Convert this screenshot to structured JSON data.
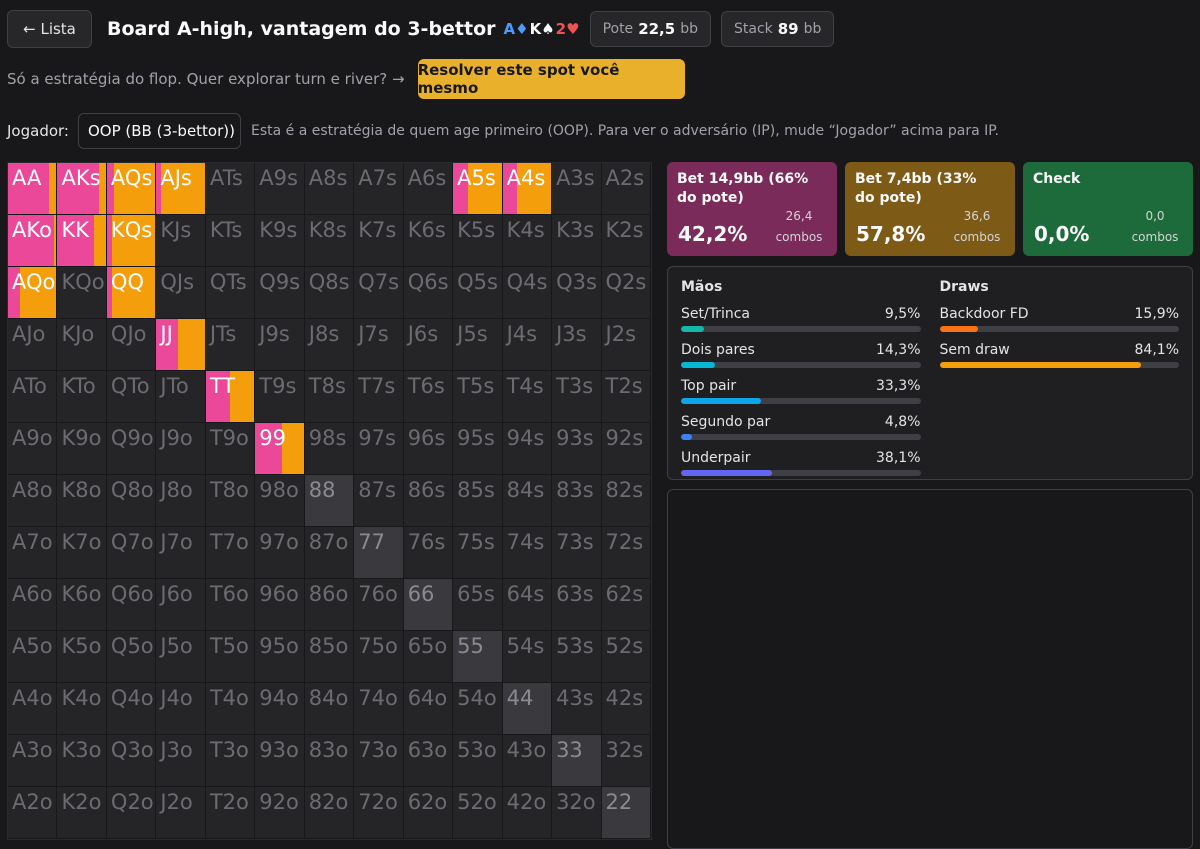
{
  "header": {
    "back_label": "← Lista",
    "title": "Board A-high, vantagem do 3-bettor",
    "board": [
      {
        "rank": "A",
        "suit": "♦",
        "color": "#4b9bff"
      },
      {
        "rank": "K",
        "suit": "♠",
        "color": "#fafafa"
      },
      {
        "rank": "2",
        "suit": "♥",
        "color": "#f05252"
      }
    ],
    "pot_label": "Pote",
    "pot_value": "22,5",
    "pot_unit": "bb",
    "stack_label": "Stack",
    "stack_value": "89",
    "stack_unit": "bb"
  },
  "cta": {
    "text": "Só a estratégia do flop. Quer explorar turn e river? →",
    "button": "Resolver este spot você mesmo"
  },
  "player": {
    "label": "Jogador:",
    "selected": "OOP (BB (3-bettor))",
    "help": "Esta é a estratégia de quem age primeiro (OOP). Para ver o adversário (IP), mude “Jogador” acima para IP."
  },
  "colors": {
    "bet_large": "#ec4899",
    "bet_small": "#f59e0b",
    "check": "#22c55e"
  },
  "actions": [
    {
      "name": "Bet 14,9bb (66% do pote)",
      "pct": "42,2%",
      "combos_value": "26,4",
      "combos_label": "combos",
      "bg": "#7a2b59"
    },
    {
      "name": "Bet 7,4bb (33% do pote)",
      "pct": "57,8%",
      "combos_value": "36,6",
      "combos_label": "combos",
      "bg": "#7d5a16"
    },
    {
      "name": "Check",
      "pct": "0,0%",
      "combos_value": "0,0",
      "combos_label": "combos",
      "bg": "#1d6b3a"
    }
  ],
  "stats": {
    "hands_title": "Mãos",
    "hands": [
      {
        "name": "Set/Trinca",
        "pct": "9,5%",
        "fraction": 0.095,
        "color": "#14b8a6"
      },
      {
        "name": "Dois pares",
        "pct": "14,3%",
        "fraction": 0.143,
        "color": "#06b6d4"
      },
      {
        "name": "Top pair",
        "pct": "33,3%",
        "fraction": 0.333,
        "color": "#0ea5e9"
      },
      {
        "name": "Segundo par",
        "pct": "4,8%",
        "fraction": 0.048,
        "color": "#3b82f6"
      },
      {
        "name": "Underpair",
        "pct": "38,1%",
        "fraction": 0.381,
        "color": "#6366f1"
      }
    ],
    "draws_title": "Draws",
    "draws": [
      {
        "name": "Backdoor FD",
        "pct": "15,9%",
        "fraction": 0.159,
        "color": "#f97316"
      },
      {
        "name": "Sem draw",
        "pct": "84,1%",
        "fraction": 0.841,
        "color": "#f59e0b"
      }
    ]
  },
  "matrix": {
    "rows": [
      [
        "AA",
        "AKs",
        "AQs",
        "AJs",
        "ATs",
        "A9s",
        "A8s",
        "A7s",
        "A6s",
        "A5s",
        "A4s",
        "A3s",
        "A2s"
      ],
      [
        "AKo",
        "KK",
        "KQs",
        "KJs",
        "KTs",
        "K9s",
        "K8s",
        "K7s",
        "K6s",
        "K5s",
        "K4s",
        "K3s",
        "K2s"
      ],
      [
        "AQo",
        "KQo",
        "QQ",
        "QJs",
        "QTs",
        "Q9s",
        "Q8s",
        "Q7s",
        "Q6s",
        "Q5s",
        "Q4s",
        "Q3s",
        "Q2s"
      ],
      [
        "AJo",
        "KJo",
        "QJo",
        "JJ",
        "JTs",
        "J9s",
        "J8s",
        "J7s",
        "J6s",
        "J5s",
        "J4s",
        "J3s",
        "J2s"
      ],
      [
        "ATo",
        "KTo",
        "QTo",
        "JTo",
        "TT",
        "T9s",
        "T8s",
        "T7s",
        "T6s",
        "T5s",
        "T4s",
        "T3s",
        "T2s"
      ],
      [
        "A9o",
        "K9o",
        "Q9o",
        "J9o",
        "T9o",
        "99",
        "98s",
        "97s",
        "96s",
        "95s",
        "94s",
        "93s",
        "92s"
      ],
      [
        "A8o",
        "K8o",
        "Q8o",
        "J8o",
        "T8o",
        "98o",
        "88",
        "87s",
        "86s",
        "85s",
        "84s",
        "83s",
        "82s"
      ],
      [
        "A7o",
        "K7o",
        "Q7o",
        "J7o",
        "T7o",
        "97o",
        "87o",
        "77",
        "76s",
        "75s",
        "74s",
        "73s",
        "72s"
      ],
      [
        "A6o",
        "K6o",
        "Q6o",
        "J6o",
        "T6o",
        "96o",
        "86o",
        "76o",
        "66",
        "65s",
        "64s",
        "63s",
        "62s"
      ],
      [
        "A5o",
        "K5o",
        "Q5o",
        "J5o",
        "T5o",
        "95o",
        "85o",
        "75o",
        "65o",
        "55",
        "54s",
        "53s",
        "52s"
      ],
      [
        "A4o",
        "K4o",
        "Q4o",
        "J4o",
        "T4o",
        "94o",
        "84o",
        "74o",
        "64o",
        "54o",
        "44",
        "43s",
        "42s"
      ],
      [
        "A3o",
        "K3o",
        "Q3o",
        "J3o",
        "T3o",
        "93o",
        "83o",
        "73o",
        "63o",
        "53o",
        "43o",
        "33",
        "32s"
      ],
      [
        "A2o",
        "K2o",
        "Q2o",
        "J2o",
        "T2o",
        "92o",
        "82o",
        "72o",
        "62o",
        "52o",
        "42o",
        "32o",
        "22"
      ]
    ],
    "strategy": {
      "AA": [
        0.85,
        0.15
      ],
      "AKs": [
        0.85,
        0.15
      ],
      "AQs": [
        0.15,
        0.85
      ],
      "AJs": [
        0.1,
        0.9
      ],
      "A5s": [
        0.3,
        0.7
      ],
      "A4s": [
        0.3,
        0.7
      ],
      "AKo": [
        0.95,
        0.05
      ],
      "KK": [
        0.75,
        0.25
      ],
      "KQs": [
        0.1,
        0.9
      ],
      "AQo": [
        0.25,
        0.75
      ],
      "QQ": [
        0.1,
        0.9
      ],
      "JJ": [
        0.45,
        0.55
      ],
      "TT": [
        0.5,
        0.5
      ],
      "99": [
        0.55,
        0.45
      ]
    }
  }
}
